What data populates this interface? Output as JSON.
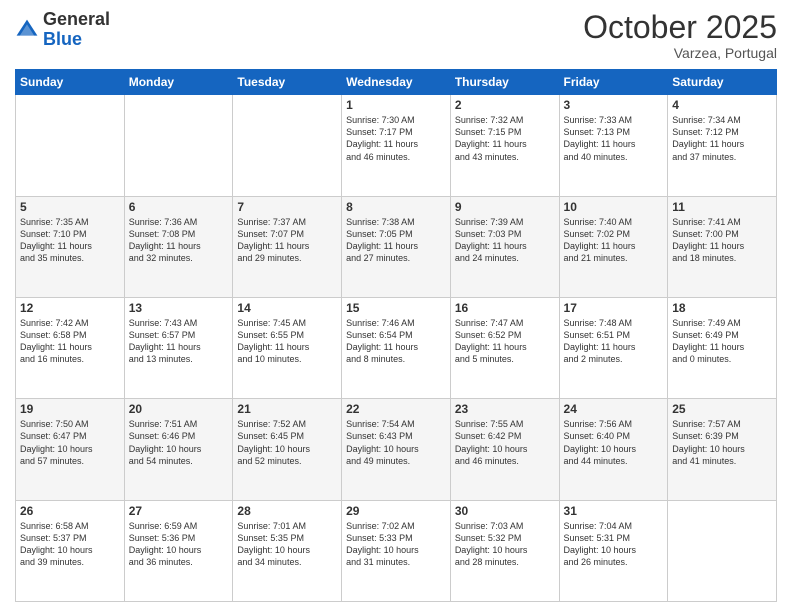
{
  "header": {
    "logo_general": "General",
    "logo_blue": "Blue",
    "month_title": "October 2025",
    "location": "Varzea, Portugal"
  },
  "days_of_week": [
    "Sunday",
    "Monday",
    "Tuesday",
    "Wednesday",
    "Thursday",
    "Friday",
    "Saturday"
  ],
  "weeks": [
    [
      {
        "day": "",
        "info": ""
      },
      {
        "day": "",
        "info": ""
      },
      {
        "day": "",
        "info": ""
      },
      {
        "day": "1",
        "info": "Sunrise: 7:30 AM\nSunset: 7:17 PM\nDaylight: 11 hours\nand 46 minutes."
      },
      {
        "day": "2",
        "info": "Sunrise: 7:32 AM\nSunset: 7:15 PM\nDaylight: 11 hours\nand 43 minutes."
      },
      {
        "day": "3",
        "info": "Sunrise: 7:33 AM\nSunset: 7:13 PM\nDaylight: 11 hours\nand 40 minutes."
      },
      {
        "day": "4",
        "info": "Sunrise: 7:34 AM\nSunset: 7:12 PM\nDaylight: 11 hours\nand 37 minutes."
      }
    ],
    [
      {
        "day": "5",
        "info": "Sunrise: 7:35 AM\nSunset: 7:10 PM\nDaylight: 11 hours\nand 35 minutes."
      },
      {
        "day": "6",
        "info": "Sunrise: 7:36 AM\nSunset: 7:08 PM\nDaylight: 11 hours\nand 32 minutes."
      },
      {
        "day": "7",
        "info": "Sunrise: 7:37 AM\nSunset: 7:07 PM\nDaylight: 11 hours\nand 29 minutes."
      },
      {
        "day": "8",
        "info": "Sunrise: 7:38 AM\nSunset: 7:05 PM\nDaylight: 11 hours\nand 27 minutes."
      },
      {
        "day": "9",
        "info": "Sunrise: 7:39 AM\nSunset: 7:03 PM\nDaylight: 11 hours\nand 24 minutes."
      },
      {
        "day": "10",
        "info": "Sunrise: 7:40 AM\nSunset: 7:02 PM\nDaylight: 11 hours\nand 21 minutes."
      },
      {
        "day": "11",
        "info": "Sunrise: 7:41 AM\nSunset: 7:00 PM\nDaylight: 11 hours\nand 18 minutes."
      }
    ],
    [
      {
        "day": "12",
        "info": "Sunrise: 7:42 AM\nSunset: 6:58 PM\nDaylight: 11 hours\nand 16 minutes."
      },
      {
        "day": "13",
        "info": "Sunrise: 7:43 AM\nSunset: 6:57 PM\nDaylight: 11 hours\nand 13 minutes."
      },
      {
        "day": "14",
        "info": "Sunrise: 7:45 AM\nSunset: 6:55 PM\nDaylight: 11 hours\nand 10 minutes."
      },
      {
        "day": "15",
        "info": "Sunrise: 7:46 AM\nSunset: 6:54 PM\nDaylight: 11 hours\nand 8 minutes."
      },
      {
        "day": "16",
        "info": "Sunrise: 7:47 AM\nSunset: 6:52 PM\nDaylight: 11 hours\nand 5 minutes."
      },
      {
        "day": "17",
        "info": "Sunrise: 7:48 AM\nSunset: 6:51 PM\nDaylight: 11 hours\nand 2 minutes."
      },
      {
        "day": "18",
        "info": "Sunrise: 7:49 AM\nSunset: 6:49 PM\nDaylight: 11 hours\nand 0 minutes."
      }
    ],
    [
      {
        "day": "19",
        "info": "Sunrise: 7:50 AM\nSunset: 6:47 PM\nDaylight: 10 hours\nand 57 minutes."
      },
      {
        "day": "20",
        "info": "Sunrise: 7:51 AM\nSunset: 6:46 PM\nDaylight: 10 hours\nand 54 minutes."
      },
      {
        "day": "21",
        "info": "Sunrise: 7:52 AM\nSunset: 6:45 PM\nDaylight: 10 hours\nand 52 minutes."
      },
      {
        "day": "22",
        "info": "Sunrise: 7:54 AM\nSunset: 6:43 PM\nDaylight: 10 hours\nand 49 minutes."
      },
      {
        "day": "23",
        "info": "Sunrise: 7:55 AM\nSunset: 6:42 PM\nDaylight: 10 hours\nand 46 minutes."
      },
      {
        "day": "24",
        "info": "Sunrise: 7:56 AM\nSunset: 6:40 PM\nDaylight: 10 hours\nand 44 minutes."
      },
      {
        "day": "25",
        "info": "Sunrise: 7:57 AM\nSunset: 6:39 PM\nDaylight: 10 hours\nand 41 minutes."
      }
    ],
    [
      {
        "day": "26",
        "info": "Sunrise: 6:58 AM\nSunset: 5:37 PM\nDaylight: 10 hours\nand 39 minutes."
      },
      {
        "day": "27",
        "info": "Sunrise: 6:59 AM\nSunset: 5:36 PM\nDaylight: 10 hours\nand 36 minutes."
      },
      {
        "day": "28",
        "info": "Sunrise: 7:01 AM\nSunset: 5:35 PM\nDaylight: 10 hours\nand 34 minutes."
      },
      {
        "day": "29",
        "info": "Sunrise: 7:02 AM\nSunset: 5:33 PM\nDaylight: 10 hours\nand 31 minutes."
      },
      {
        "day": "30",
        "info": "Sunrise: 7:03 AM\nSunset: 5:32 PM\nDaylight: 10 hours\nand 28 minutes."
      },
      {
        "day": "31",
        "info": "Sunrise: 7:04 AM\nSunset: 5:31 PM\nDaylight: 10 hours\nand 26 minutes."
      },
      {
        "day": "",
        "info": ""
      }
    ]
  ]
}
